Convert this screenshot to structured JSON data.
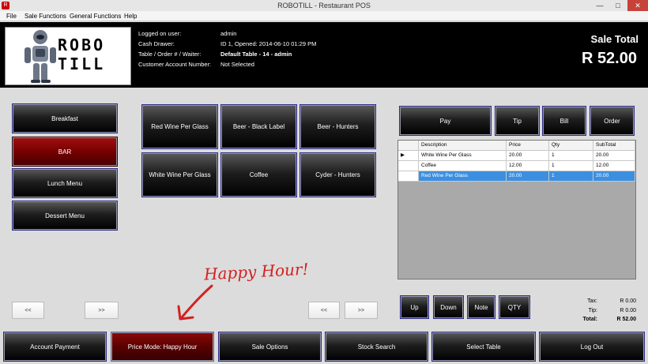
{
  "window": {
    "title": "ROBOTILL - Restaurant POS",
    "min": "—",
    "max": "□",
    "close": "✕"
  },
  "menu": [
    "File",
    "Sale Functions",
    "General Functions",
    "Help"
  ],
  "logo": {
    "line1": "ROBO",
    "line2": "TILL"
  },
  "info": {
    "logged_on_label": "Logged on user:",
    "logged_on_value": "admin",
    "cash_drawer_label": "Cash Drawer:",
    "cash_drawer_value": "ID 1, Opened: 2014-06-10 01:29 PM",
    "table_label": "Table / Order # / Waiter:",
    "table_value": "Default Table - 14 - admin",
    "account_label": "Customer Account Number:",
    "account_value": "Not Selected"
  },
  "sale_total": {
    "label": "Sale Total",
    "value": "R 52.00"
  },
  "categories": [
    "Breakfast",
    "BAR",
    "Lunch Menu",
    "Dessert Menu"
  ],
  "products": [
    "Red Wine Per Glass",
    "Beer - Black Label",
    "Beer - Hunters",
    "White Wine Per Glass",
    "Coffee",
    "Cyder - Hunters"
  ],
  "actions": [
    "Pay",
    "Tip",
    "Bill",
    "Order"
  ],
  "grid": {
    "headers": [
      "Description",
      "Price",
      "Qty",
      "SubTotal"
    ],
    "rows": [
      {
        "marker": "▶",
        "description": "White Wine Per Glass",
        "price": "20.00",
        "qty": "1",
        "subtotal": "20.00"
      },
      {
        "marker": "",
        "description": "Coffee",
        "price": "12.00",
        "qty": "1",
        "subtotal": "12.00"
      },
      {
        "marker": "",
        "description": "Red Wine Per Glass",
        "price": "20.00",
        "qty": "1",
        "subtotal": "20.00"
      }
    ]
  },
  "nav": {
    "prev": "<<",
    "next": ">>"
  },
  "line_buttons": [
    "Up",
    "Down",
    "Note",
    "QTY"
  ],
  "summary": {
    "tax_label": "Tax:",
    "tax_value": "R 0.00",
    "tip_label": "Tip:",
    "tip_value": "R 0.00",
    "total_label": "Total:",
    "total_value": "R 52.00"
  },
  "bottom": [
    "Account Payment",
    "Price Mode: Happy Hour",
    "Sale Options",
    "Stock Search",
    "Select Table",
    "Log Out"
  ],
  "annotation": "Happy Hour!",
  "colors": {
    "accent_red": "#d42020",
    "selection": "#3c8fe0",
    "header_bg": "#000000"
  }
}
